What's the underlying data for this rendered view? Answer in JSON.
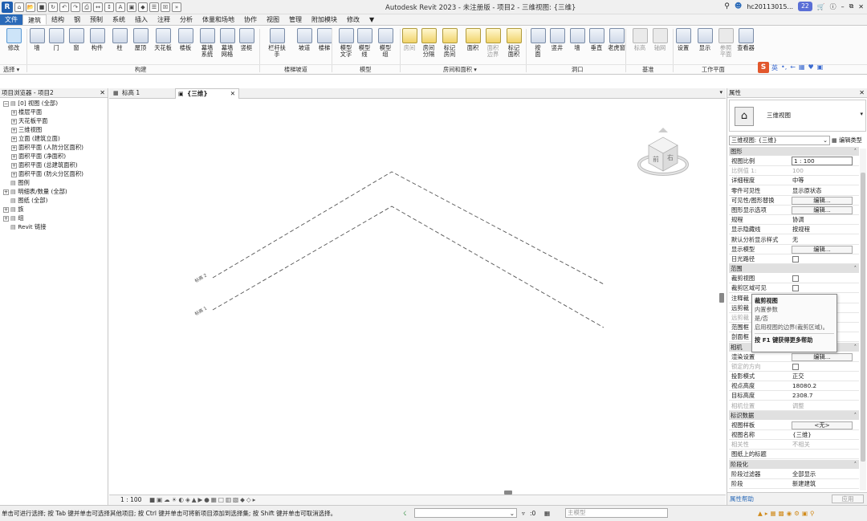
{
  "app": {
    "title": "Autodesk Revit 2023 - 未注册版 - 项目2 - 三维视图: {三维}",
    "user": "hc20113015...",
    "badge": "22",
    "logo": "R"
  },
  "ribbon_tabs": [
    "文件",
    "建筑",
    "结构",
    "钢",
    "预制",
    "系统",
    "插入",
    "注释",
    "分析",
    "体量和场地",
    "协作",
    "视图",
    "管理",
    "附加模块",
    "修改",
    "▼"
  ],
  "ribbon_tools": [
    {
      "label": "修改",
      "sub": "",
      "state": "selected"
    },
    {
      "label": "墙",
      "sub": ""
    },
    {
      "label": "门",
      "sub": ""
    },
    {
      "label": "窗",
      "sub": ""
    },
    {
      "label": "构件",
      "sub": ""
    },
    {
      "label": "柱",
      "sub": ""
    },
    {
      "label": "屋顶",
      "sub": ""
    },
    {
      "label": "天花板",
      "sub": ""
    },
    {
      "label": "楼板",
      "sub": ""
    },
    {
      "label": "幕墙",
      "sub": "系统"
    },
    {
      "label": "幕墙",
      "sub": "网格"
    },
    {
      "label": "竖梃",
      "sub": ""
    },
    {
      "label": "栏杆扶手",
      "sub": ""
    },
    {
      "label": "坡道",
      "sub": ""
    },
    {
      "label": "楼梯",
      "sub": ""
    },
    {
      "label": "模型",
      "sub": "文字"
    },
    {
      "label": "模型",
      "sub": "线"
    },
    {
      "label": "模型",
      "sub": "组"
    },
    {
      "label": "房间",
      "sub": "",
      "state": "dim"
    },
    {
      "label": "房间",
      "sub": "分隔"
    },
    {
      "label": "标记",
      "sub": "房间"
    },
    {
      "label": "面积",
      "sub": ""
    },
    {
      "label": "面积",
      "sub": "边界",
      "state": "dim"
    },
    {
      "label": "标记",
      "sub": "面积"
    },
    {
      "label": "按",
      "sub": "面"
    },
    {
      "label": "竖井",
      "sub": ""
    },
    {
      "label": "墙",
      "sub": ""
    },
    {
      "label": "垂直",
      "sub": ""
    },
    {
      "label": "老虎窗",
      "sub": ""
    },
    {
      "label": "标高",
      "sub": "",
      "state": "dim"
    },
    {
      "label": "轴网",
      "sub": "",
      "state": "dim"
    },
    {
      "label": "设置",
      "sub": ""
    },
    {
      "label": "显示",
      "sub": ""
    },
    {
      "label": "参照",
      "sub": "平面",
      "state": "dim"
    },
    {
      "label": "查看器",
      "sub": ""
    }
  ],
  "ribbon_panels": [
    "选择 ▾",
    "构建",
    "楼梯坡道",
    "模型",
    "房间和面积 ▾",
    "洞口",
    "基准",
    "工作平面"
  ],
  "ime": {
    "s": "S",
    "items": [
      "英",
      "•,",
      "←",
      "▦",
      "♥",
      "▣"
    ]
  },
  "browser": {
    "title": "项目浏览器 - 项目2",
    "close": "✕",
    "items": [
      {
        "label": "[0] 视图 (全部)",
        "indent": 0,
        "toggle": "−"
      },
      {
        "label": "楼层平面",
        "indent": 1,
        "toggle": "+"
      },
      {
        "label": "天花板平面",
        "indent": 1,
        "toggle": "+"
      },
      {
        "label": "三维视图",
        "indent": 1,
        "toggle": "+"
      },
      {
        "label": "立面 (建筑立面)",
        "indent": 1,
        "toggle": "+"
      },
      {
        "label": "面积平面 (人防分区面积)",
        "indent": 1,
        "toggle": "+"
      },
      {
        "label": "面积平面 (净面积)",
        "indent": 1,
        "toggle": "+"
      },
      {
        "label": "面积平面 (总建筑面积)",
        "indent": 1,
        "toggle": "+"
      },
      {
        "label": "面积平面 (防火分区面积)",
        "indent": 1,
        "toggle": "+"
      },
      {
        "label": "图例",
        "indent": 0,
        "toggle": ""
      },
      {
        "label": "明细表/数量 (全部)",
        "indent": 0,
        "toggle": "+"
      },
      {
        "label": "图纸 (全部)",
        "indent": 0,
        "toggle": ""
      },
      {
        "label": "族",
        "indent": 0,
        "toggle": "+"
      },
      {
        "label": "组",
        "indent": 0,
        "toggle": "+"
      },
      {
        "label": "Revit 链接",
        "indent": 0,
        "toggle": ""
      }
    ]
  },
  "view_tabs": [
    {
      "label": "标高 1",
      "close": "✕"
    },
    {
      "label": "{三维}",
      "close": "✕"
    }
  ],
  "viewcube": {
    "front": "前",
    "right": "右"
  },
  "level_labels": [
    "标高 2",
    "标高 1"
  ],
  "view_bar": {
    "scale": "1 : 100"
  },
  "properties": {
    "title": "属性",
    "close": "✕",
    "type_name": "三维视图",
    "instance_selector": "三维视图: {三维}",
    "edit_type": "编辑类型",
    "groups": [
      {
        "name": "图形",
        "rows": [
          {
            "k": "视图比例",
            "v": "1 : 100",
            "kind": "input"
          },
          {
            "k": "比例值 1:",
            "v": "100",
            "kind": "text",
            "dim": true
          },
          {
            "k": "详细程度",
            "v": "中等",
            "kind": "text"
          },
          {
            "k": "零件可见性",
            "v": "显示原状态",
            "kind": "text"
          },
          {
            "k": "可见性/图形替换",
            "v": "编辑...",
            "kind": "button"
          },
          {
            "k": "图形显示选项",
            "v": "编辑...",
            "kind": "button"
          },
          {
            "k": "规程",
            "v": "协调",
            "kind": "text"
          },
          {
            "k": "显示隐藏线",
            "v": "按规程",
            "kind": "text"
          },
          {
            "k": "默认分析显示样式",
            "v": "无",
            "kind": "text"
          },
          {
            "k": "显示模型",
            "v": "编辑...",
            "kind": "button"
          },
          {
            "k": "日光路径",
            "v": "",
            "kind": "checkbox"
          }
        ]
      },
      {
        "name": "范围",
        "rows": [
          {
            "k": "裁剪视图",
            "v": "",
            "kind": "checkbox"
          },
          {
            "k": "裁剪区域可见",
            "v": "",
            "kind": "checkbox"
          },
          {
            "k": "注释裁",
            "v": "",
            "kind": "text"
          },
          {
            "k": "远剪裁",
            "v": "",
            "kind": "text"
          },
          {
            "k": "远剪裁",
            "v": "",
            "kind": "text",
            "dim": true
          },
          {
            "k": "范围框",
            "v": "",
            "kind": "text"
          },
          {
            "k": "剖面框",
            "v": "",
            "kind": "text"
          }
        ]
      },
      {
        "name": "相机",
        "rows": [
          {
            "k": "渲染设置",
            "v": "编辑...",
            "kind": "button"
          },
          {
            "k": "锁定的方向",
            "v": "",
            "kind": "checkbox",
            "dim": true
          },
          {
            "k": "投影模式",
            "v": "正交",
            "kind": "text"
          },
          {
            "k": "视点高度",
            "v": "18080.2",
            "kind": "text"
          },
          {
            "k": "目标高度",
            "v": "2308.7",
            "kind": "text"
          },
          {
            "k": "相机位置",
            "v": "调整",
            "kind": "text",
            "dim": true
          }
        ]
      },
      {
        "name": "标识数据",
        "rows": [
          {
            "k": "视图样板",
            "v": "<无>",
            "kind": "button"
          },
          {
            "k": "视图名称",
            "v": "{三维}",
            "kind": "text"
          },
          {
            "k": "相关性",
            "v": "不相关",
            "kind": "text",
            "dim": true
          },
          {
            "k": "图纸上的标题",
            "v": "",
            "kind": "text"
          }
        ]
      },
      {
        "name": "阶段化",
        "rows": [
          {
            "k": "阶段过滤器",
            "v": "全部显示",
            "kind": "text"
          },
          {
            "k": "阶段",
            "v": "新建建筑",
            "kind": "text"
          }
        ]
      }
    ],
    "help_link": "属性帮助",
    "apply": "应用"
  },
  "tooltip": {
    "title": "裁剪视图",
    "line1": "内置参数",
    "line2": "是/否",
    "line3": "启用视图的边界(裁剪区域)。",
    "help": "按 F1 键获得更多帮助"
  },
  "statusbar": {
    "message": "单击可进行选择; 按 Tab 键并单击可选择其他项目; 按 Ctrl 键并单击可将新项目添加到选择集; 按 Shift 键并单击可取消选择。",
    "zero": ":0",
    "model": "主模型"
  }
}
